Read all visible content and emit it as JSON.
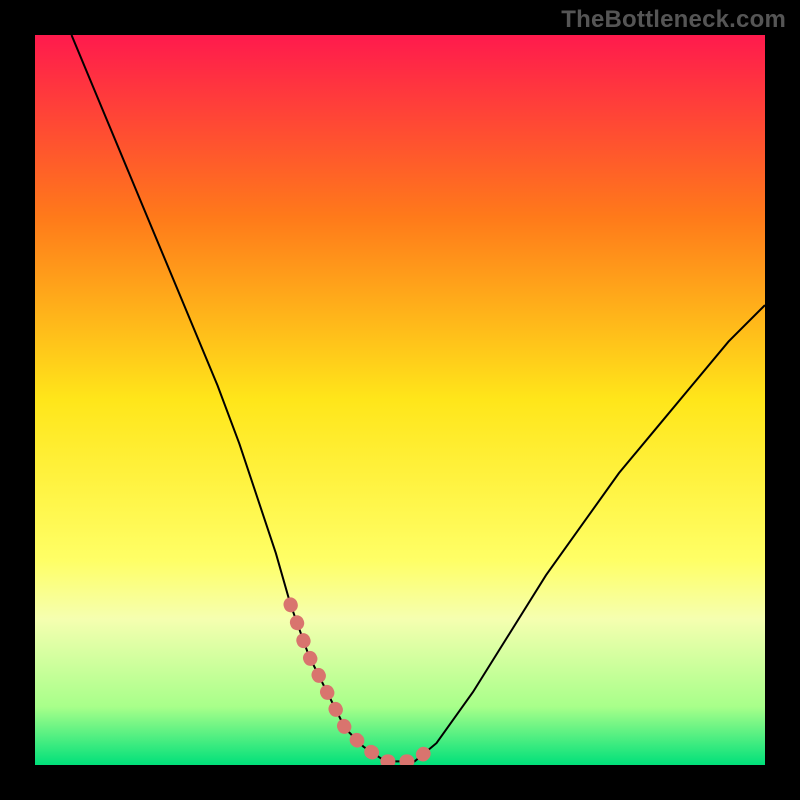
{
  "watermark": "TheBottleneck.com",
  "chart_data": {
    "type": "line",
    "title": "",
    "xlabel": "",
    "ylabel": "",
    "xlim": [
      0,
      100
    ],
    "ylim": [
      0,
      100
    ],
    "gradient_stops": [
      {
        "offset": 0,
        "color": "#ff1a4d"
      },
      {
        "offset": 25,
        "color": "#ff7a1a"
      },
      {
        "offset": 50,
        "color": "#ffe61a"
      },
      {
        "offset": 72,
        "color": "#ffff66"
      },
      {
        "offset": 80,
        "color": "#f5ffb0"
      },
      {
        "offset": 92,
        "color": "#a8ff8a"
      },
      {
        "offset": 100,
        "color": "#00e07a"
      }
    ],
    "series": [
      {
        "name": "bottleneck-curve",
        "x": [
          5,
          10,
          15,
          20,
          25,
          28,
          30,
          33,
          35,
          37.5,
          40,
          42.5,
          45,
          48,
          52,
          55,
          60,
          65,
          70,
          75,
          80,
          85,
          90,
          95,
          100
        ],
        "y": [
          100,
          88,
          76,
          64,
          52,
          44,
          38,
          29,
          22,
          15,
          10,
          5,
          2.5,
          0.5,
          0.5,
          3,
          10,
          18,
          26,
          33,
          40,
          46,
          52,
          58,
          63
        ]
      },
      {
        "name": "highlight-valley",
        "x": [
          35,
          37.5,
          40,
          42.5,
          45,
          48,
          52,
          55
        ],
        "y": [
          22,
          15,
          10,
          5,
          2.5,
          0.5,
          0.5,
          3
        ]
      }
    ]
  }
}
